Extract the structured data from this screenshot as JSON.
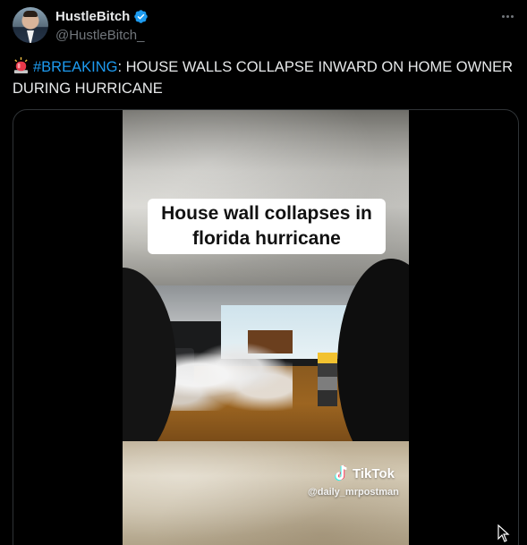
{
  "author": {
    "display_name": "HustleBitch",
    "handle": "@HustleBitch_",
    "avatar_icon": "profile-photo"
  },
  "tweet": {
    "prefix_emoji": "🚨",
    "hashtag": "#BREAKING",
    "body": ": HOUSE WALLS COLLAPSE INWARD ON HOME OWNER DURING HURRICANE"
  },
  "video": {
    "caption_line1": "House wall collapses in",
    "caption_line2": "florida hurricane",
    "watermark_brand": "TikTok",
    "watermark_user": "@daily_mrpostman"
  },
  "icons": {
    "verified": "verified-badge-icon",
    "more": "more-options-icon",
    "siren": "police-siren-icon",
    "tiktok": "tiktok-logo-icon",
    "cursor": "mouse-pointer-icon"
  },
  "colors": {
    "background": "#000000",
    "text_primary": "#e7e9ea",
    "text_secondary": "#71767b",
    "link": "#1d9bf0",
    "verified": "#1d9bf0",
    "border": "#2f3336"
  }
}
